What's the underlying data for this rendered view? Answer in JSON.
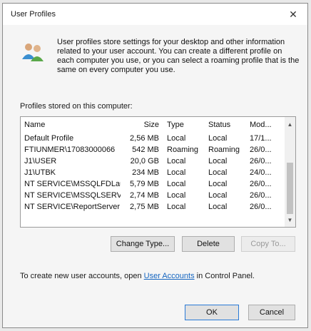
{
  "dialog": {
    "title": "User Profiles",
    "intro": "User profiles store settings for your desktop and other information related to your user account. You can create a different profile on each computer you use, or you can select a roaming profile that is the same on every computer you use.",
    "section_label": "Profiles stored on this computer:"
  },
  "table": {
    "columns": [
      "Name",
      "Size",
      "Type",
      "Status",
      "Mod..."
    ],
    "rows": [
      [
        "Default Profile",
        "2,56 MB",
        "Local",
        "Local",
        "17/1..."
      ],
      [
        "FTIUNMER\\17083000066",
        "542 MB",
        "Roaming",
        "Roaming",
        "26/0..."
      ],
      [
        "J1\\USER",
        "20,0 GB",
        "Local",
        "Local",
        "26/0..."
      ],
      [
        "J1\\UTBK",
        "234 MB",
        "Local",
        "Local",
        "24/0..."
      ],
      [
        "NT SERVICE\\MSSQLFDLaun...",
        "5,79 MB",
        "Local",
        "Local",
        "26/0..."
      ],
      [
        "NT SERVICE\\MSSQLSERVER",
        "2,74 MB",
        "Local",
        "Local",
        "26/0..."
      ],
      [
        "NT SERVICE\\ReportServer",
        "2,75 MB",
        "Local",
        "Local",
        "26/0..."
      ]
    ]
  },
  "buttons": {
    "change_type": "Change Type...",
    "delete": "Delete",
    "copy_to": "Copy To...",
    "ok": "OK",
    "cancel": "Cancel"
  },
  "footer": {
    "prefix": "To create new user accounts, open ",
    "link": "User Accounts",
    "suffix": " in Control Panel."
  },
  "icons": {
    "users": "users-icon",
    "close": "close-icon"
  }
}
